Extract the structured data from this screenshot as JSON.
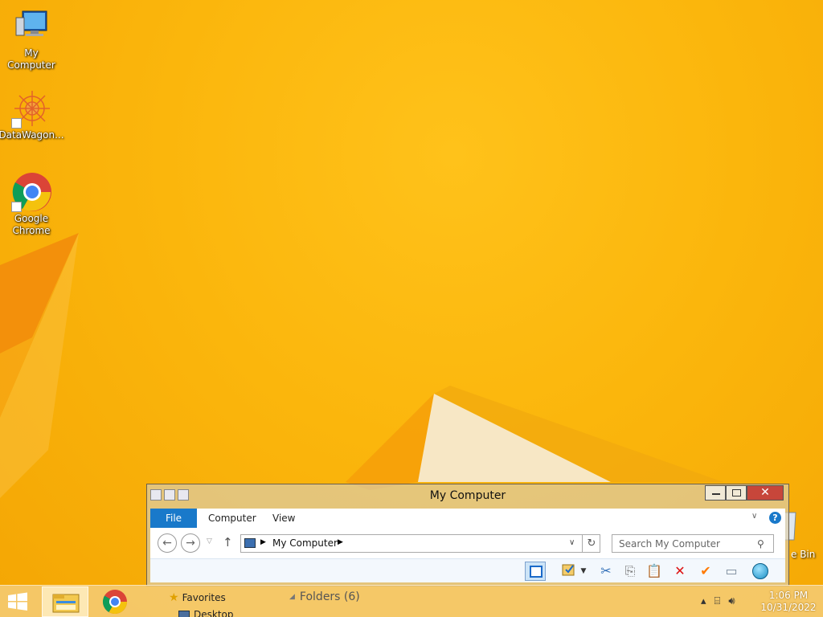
{
  "desktop": {
    "icons": [
      {
        "label": "My Computer"
      },
      {
        "label": "DataWagon..."
      },
      {
        "label": "Google\nChrome"
      }
    ],
    "recycle_bin_label_partial": "e Bin"
  },
  "window": {
    "title": "My Computer",
    "close_glyph": "✕",
    "ribbon_tabs": {
      "file": "File",
      "computer": "Computer",
      "view": "View"
    },
    "help_glyph": "?",
    "collapse_glyph": "∨",
    "nav": {
      "back_glyph": "←",
      "forward_glyph": "→",
      "recent_glyph": "▽",
      "up_glyph": "↑"
    },
    "address": {
      "path": "My Computer",
      "arrow": "▶",
      "dropdown_glyph": "∨",
      "refresh_glyph": "↻"
    },
    "search": {
      "placeholder": "Search My Computer",
      "icon_glyph": "⚲"
    },
    "toolbar": {
      "dropdown_glyph": "▼",
      "cut": "✂",
      "copy": "⎘",
      "paste": "📋",
      "delete": "✕",
      "check": "✔",
      "rename": "▭"
    }
  },
  "explorer_behind": {
    "favorites": "Favorites",
    "desktop": "Desktop",
    "folders_header": "Folders (6)"
  },
  "taskbar": {
    "time": "1:06 PM",
    "date": "10/31/2022",
    "tray_icons": [
      "chevron-up",
      "network",
      "volume"
    ]
  },
  "colors": {
    "wallpaper": "#f9b509",
    "ribbon_file_tab": "#1979ca",
    "close_button": "#c7463a"
  }
}
